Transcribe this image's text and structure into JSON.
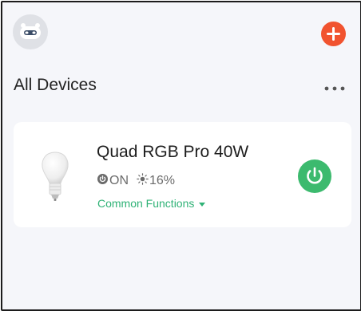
{
  "header": {
    "avatar_icon": "robot-avatar-icon",
    "add_icon": "plus-icon"
  },
  "main": {
    "title": "All Devices",
    "more_icon": "more-horizontal-icon"
  },
  "device": {
    "name": "Quad RGB Pro 40W",
    "image_icon": "light-bulb-icon",
    "power_state": "ON",
    "brightness": "16%",
    "common_functions_label": "Common Functions",
    "power_button_icon": "power-icon"
  },
  "colors": {
    "accent_green": "#3cba6e",
    "add_red": "#f1532f",
    "background": "#f5f6fa"
  }
}
